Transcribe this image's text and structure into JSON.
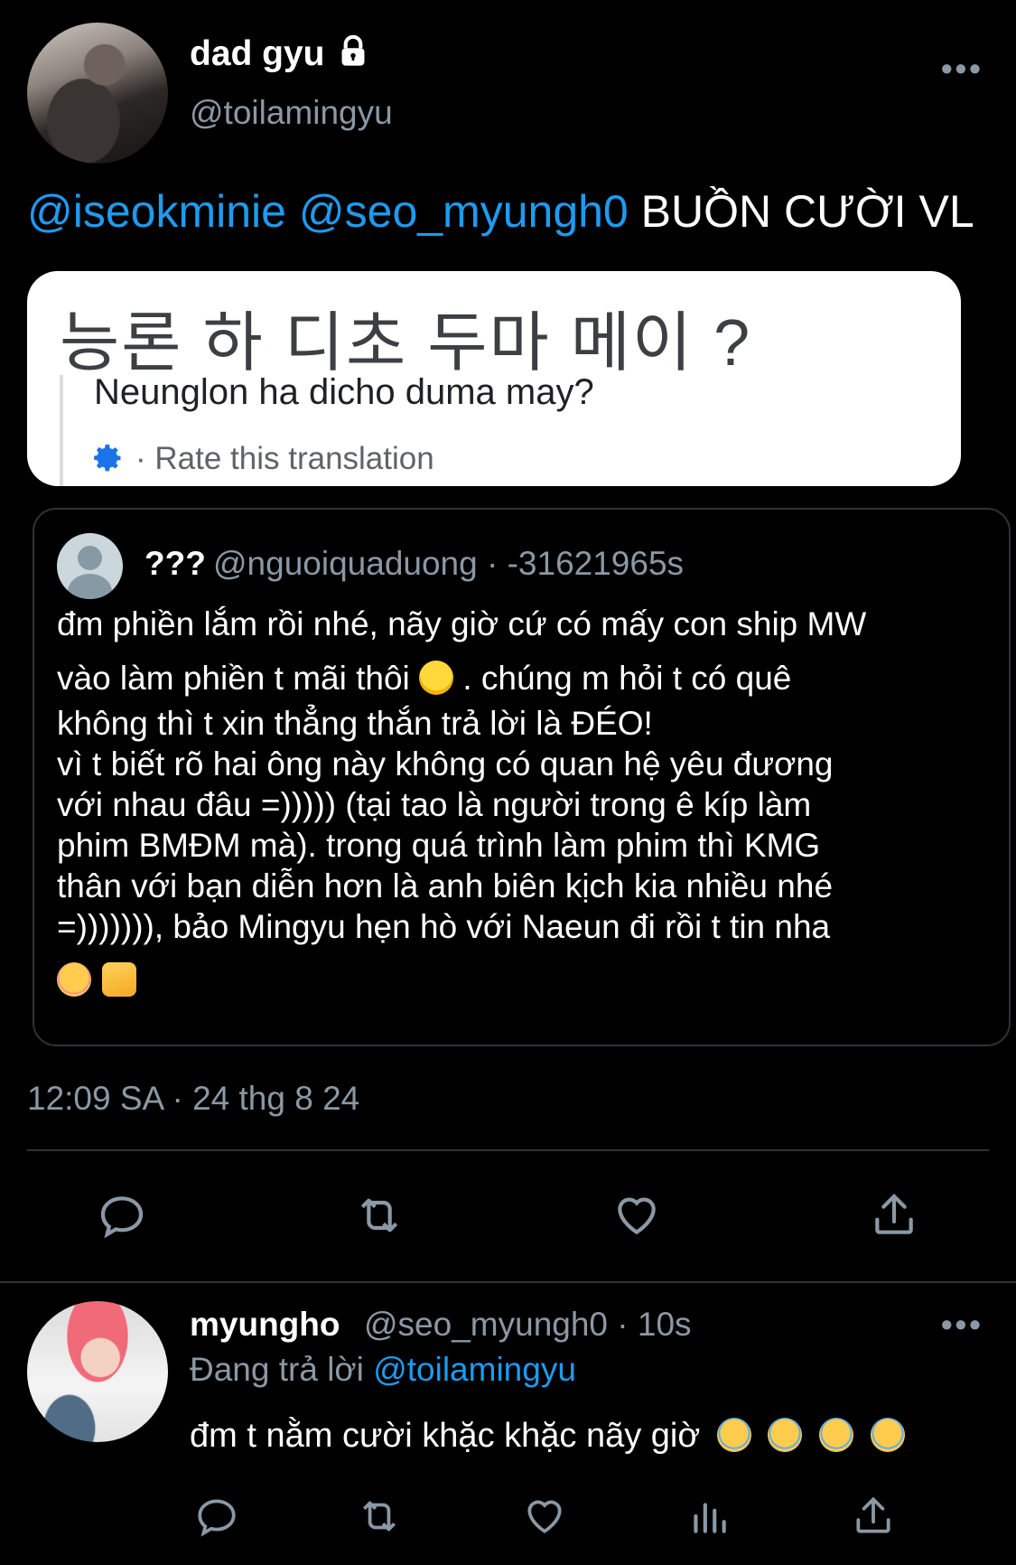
{
  "main_tweet": {
    "display_name": "dad gyu",
    "handle": "@toilamingyu",
    "mention_1": "@iseokminie",
    "mention_2": "@seo_myungh0",
    "text": "BUỒN CƯỜI VL",
    "more_label": "•••",
    "timestamp": "12:09 SA · 24 thg 8 24"
  },
  "media": {
    "korean_text": "능론 하 디초 두마 메이 ?",
    "translation": "Neunglon ha dicho duma may?",
    "rate_label": "· Rate this translation"
  },
  "quoted_tweet": {
    "display_name": "???",
    "meta": "@nguoiquaduong · -31621965s",
    "line_1": "đm phiền lắm rồi nhé, nãy giờ cứ có mấy con ship MW",
    "line_2a": "vào làm phiền t mãi thôi",
    "line_2b": ". chúng m hỏi t có quê",
    "line_3": "không thì t xin thẳng thắn trả lời là ĐÉO!",
    "line_4": "vì t biết rõ hai ông này không có quan hệ yêu đương",
    "line_5": "với nhau đâu =))))) (tại tao là người trong ê kíp làm",
    "line_6": "phim BMĐM mà). trong quá trình làm phim thì KMG",
    "line_7": "thân với bạn diễn hơn là anh biên kịch kia nhiều nhé",
    "line_8": "=))))))), bảo Mingyu hẹn hò với Naeun đi rồi t tin nha"
  },
  "reply": {
    "display_name": "myungho",
    "meta": "@seo_myungh0 · 10s",
    "replying_prefix": "Đang trả lời",
    "replying_to": "@toilamingyu",
    "text": "đm t nằm cười khặc khặc nãy giờ",
    "more_label": "•••"
  },
  "colors": {
    "background": "#000000",
    "accent": "#1d9bf0",
    "secondary_text": "#8b98a5",
    "border": "#2f3336"
  }
}
